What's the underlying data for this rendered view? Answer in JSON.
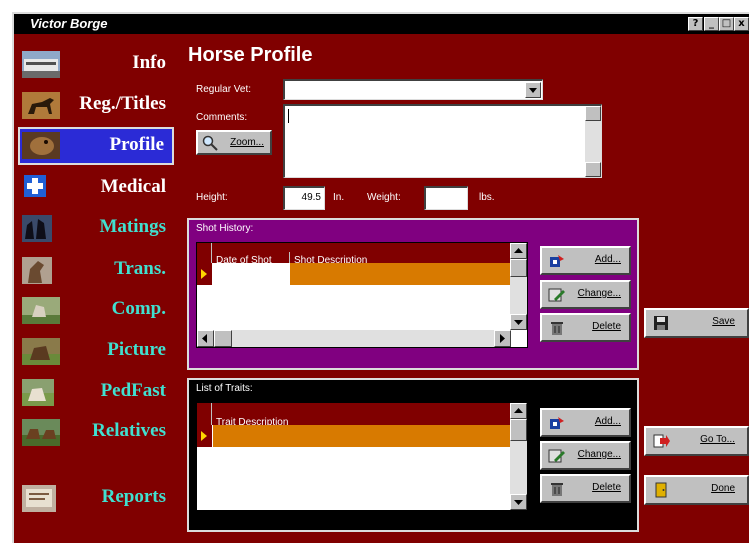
{
  "window": {
    "title": "Victor Borge",
    "help": "?",
    "minimize": "_",
    "maximize": "□",
    "close": "x"
  },
  "nav": [
    {
      "label": "Info",
      "icon": "trailer-icon",
      "color": "white"
    },
    {
      "label": "Reg./Titles",
      "icon": "horse-silhouette-icon",
      "color": "white"
    },
    {
      "label": "Profile",
      "icon": "horse-head-icon",
      "color": "white",
      "active": true
    },
    {
      "label": "Medical",
      "icon": "medical-cross-icon",
      "color": "white"
    },
    {
      "label": "Matings",
      "icon": "horse-pair-icon",
      "color": "cyan"
    },
    {
      "label": "Trans.",
      "icon": "horse-head-photo-icon",
      "color": "cyan"
    },
    {
      "label": "Comp.",
      "icon": "competition-photo-icon",
      "color": "cyan"
    },
    {
      "label": "Picture",
      "icon": "picture-photo-icon",
      "color": "cyan"
    },
    {
      "label": "PedFast",
      "icon": "pedigree-photo-icon",
      "color": "cyan"
    },
    {
      "label": "Relatives",
      "icon": "relatives-photo-icon",
      "color": "cyan"
    },
    {
      "label": "Reports",
      "icon": "reports-photo-icon",
      "color": "cyan"
    }
  ],
  "profile": {
    "title": "Horse Profile",
    "regular_vet_label": "Regular Vet:",
    "regular_vet_value": "",
    "comments_label": "Comments:",
    "comments_value": "",
    "zoom_label": "Zoom...",
    "height_label": "Height:",
    "height_value": "49.5",
    "height_unit": "In.",
    "weight_label": "Weight:",
    "weight_value": "",
    "weight_unit": "lbs."
  },
  "shot_history": {
    "title": "Shot History:",
    "columns": [
      "Date of Shot",
      "Shot Description"
    ],
    "rows": [
      [
        "",
        ""
      ]
    ],
    "add_label": "Add...",
    "change_label": "Change...",
    "delete_label": "Delete"
  },
  "traits": {
    "title": "List of Traits:",
    "columns": [
      "Trait Description"
    ],
    "rows": [
      [
        ""
      ]
    ],
    "add_label": "Add...",
    "change_label": "Change...",
    "delete_label": "Delete"
  },
  "actions": {
    "save_label": "Save",
    "goto_label": "Go To...",
    "done_label": "Done"
  },
  "colors": {
    "background": "#800000",
    "shot_panel": "#800080",
    "traits_panel": "#000000",
    "selected_row": "#d87a00",
    "active_nav": "#2b2bd6"
  }
}
